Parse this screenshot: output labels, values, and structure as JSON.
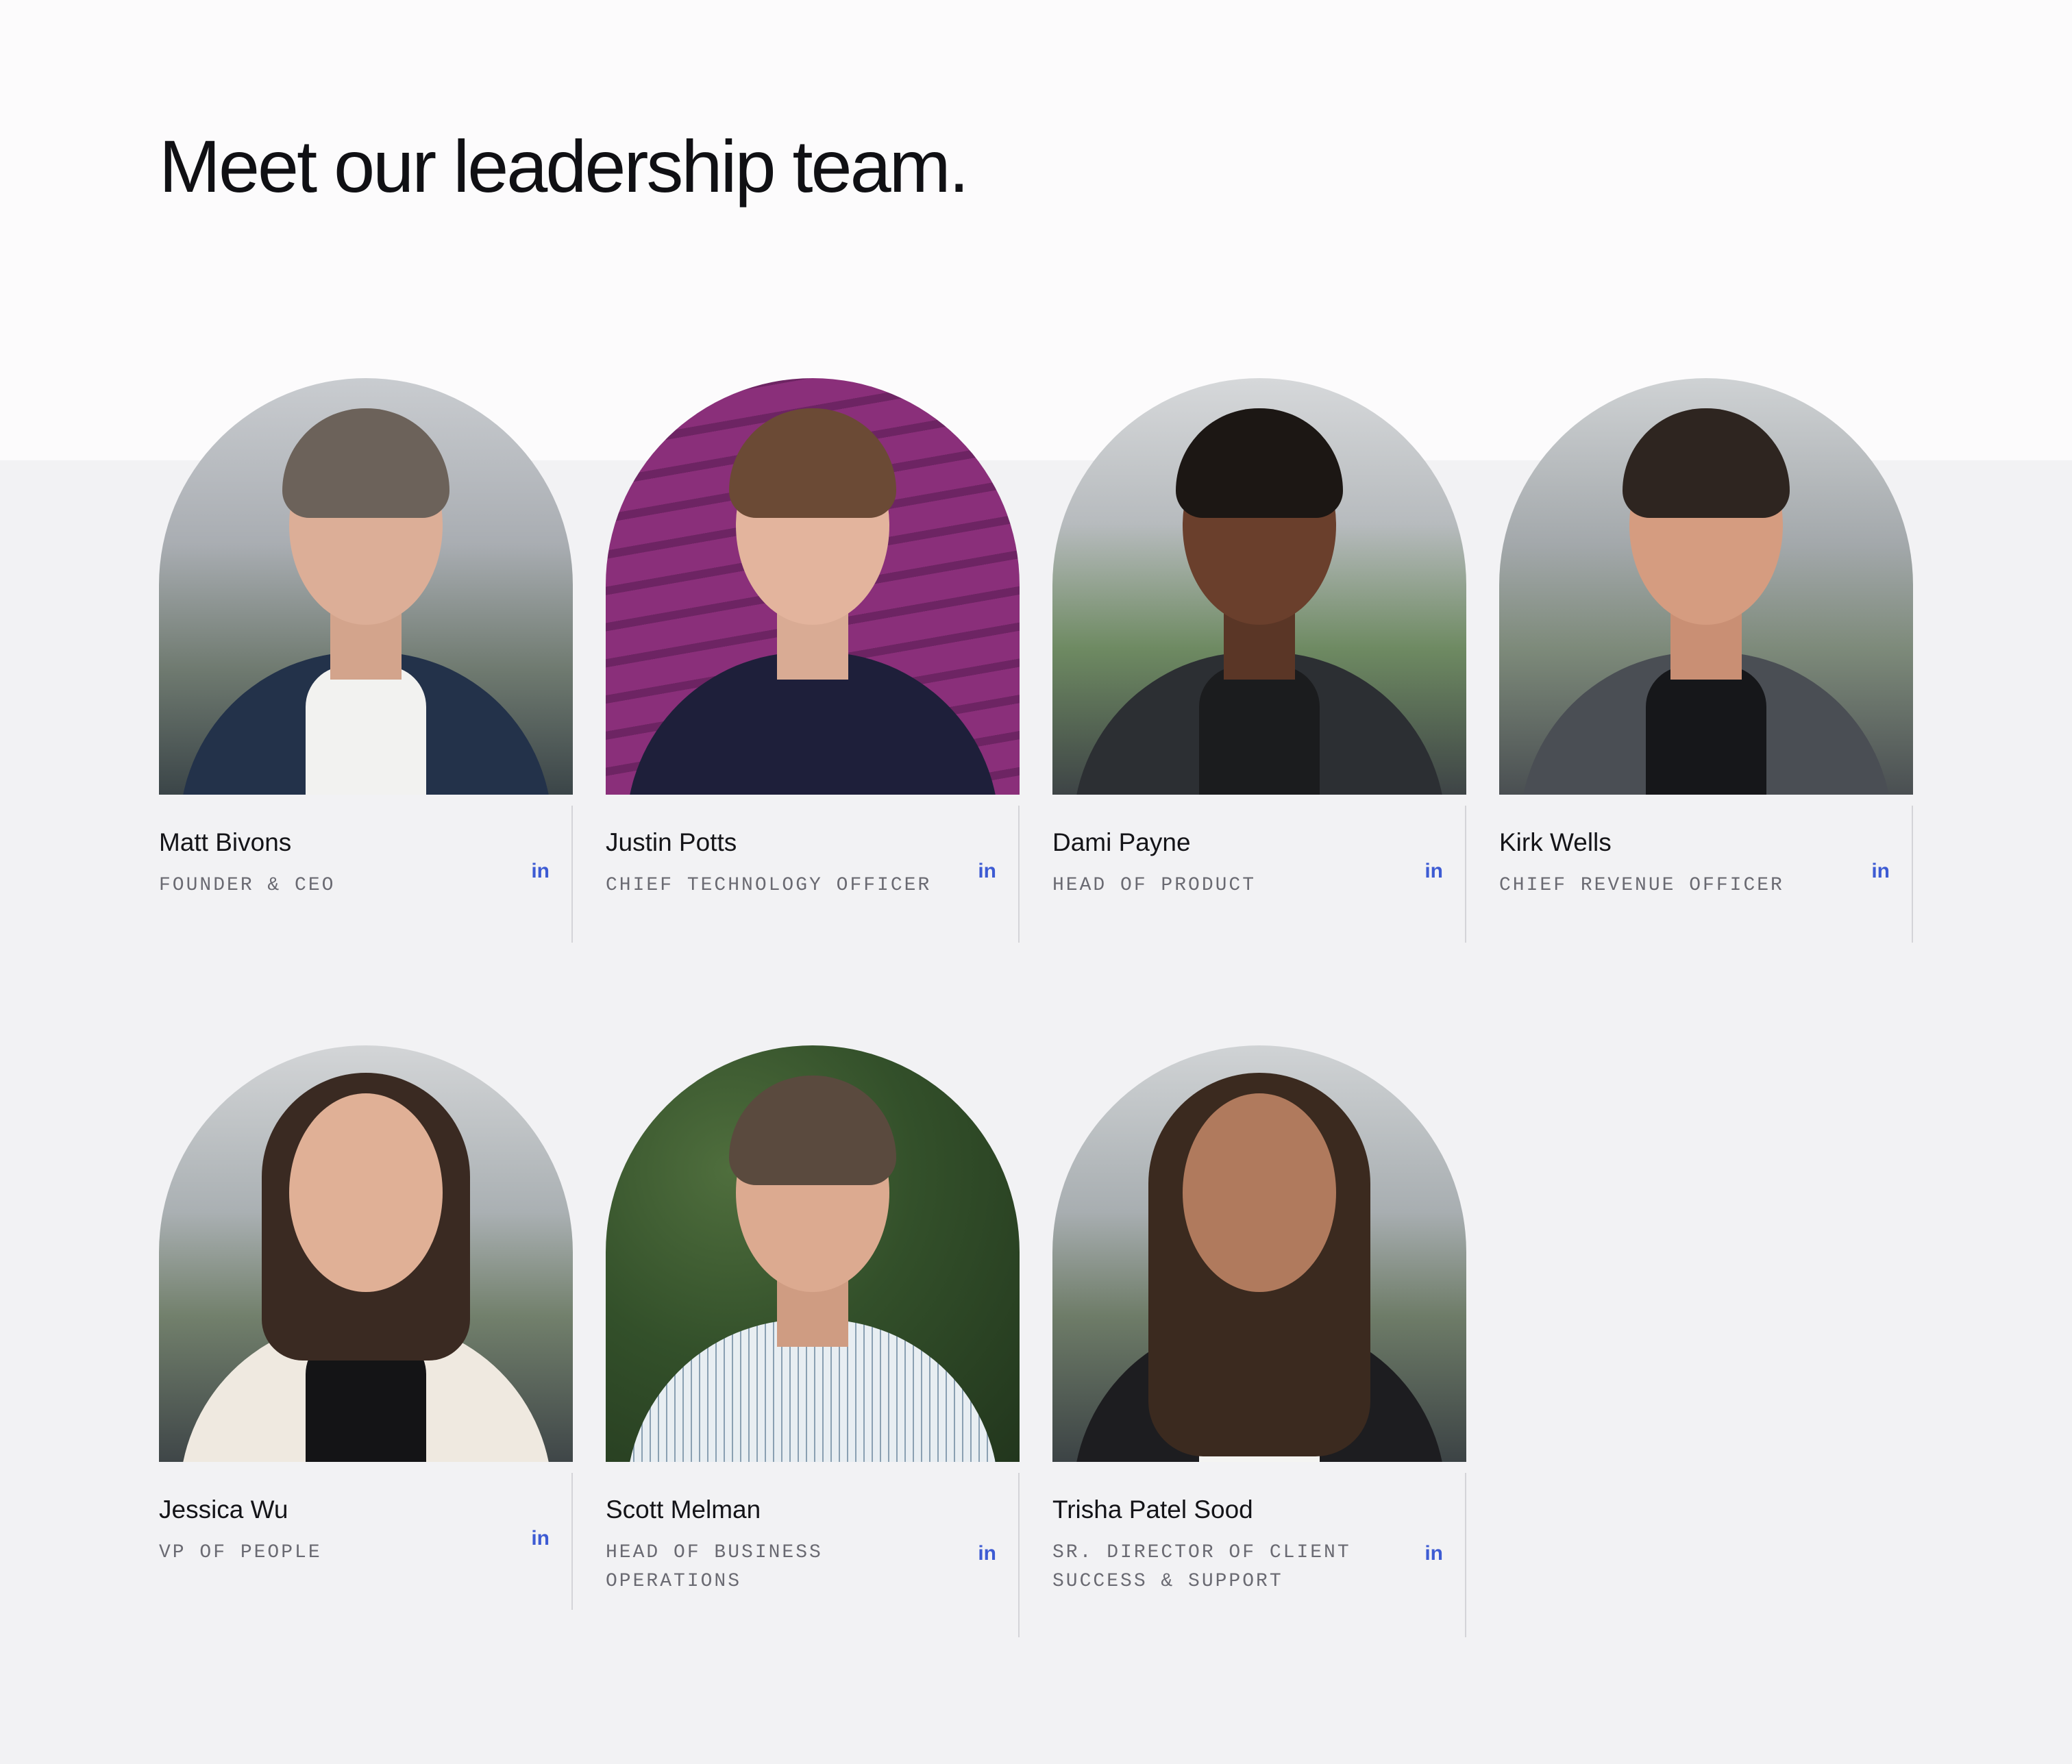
{
  "page": {
    "heading": "Meet our leadership team."
  },
  "team": [
    {
      "name": "Matt Bivons",
      "role": "FOUNDER & CEO",
      "linkedin_label": "in",
      "photo_alt": "Portrait of Matt Bivons"
    },
    {
      "name": "Justin Potts",
      "role": "CHIEF TECHNOLOGY OFFICER",
      "linkedin_label": "in",
      "photo_alt": "Portrait of Justin Potts"
    },
    {
      "name": "Dami Payne",
      "role": "HEAD OF PRODUCT",
      "linkedin_label": "in",
      "photo_alt": "Portrait of Dami Payne"
    },
    {
      "name": "Kirk Wells",
      "role": "CHIEF REVENUE OFFICER",
      "linkedin_label": "in",
      "photo_alt": "Portrait of Kirk Wells"
    },
    {
      "name": "Jessica Wu",
      "role": "VP OF PEOPLE",
      "linkedin_label": "in",
      "photo_alt": "Portrait of Jessica Wu"
    },
    {
      "name": "Scott Melman",
      "role": "HEAD OF BUSINESS OPERATIONS",
      "linkedin_label": "in",
      "photo_alt": "Portrait of Scott Melman"
    },
    {
      "name": "Trisha Patel Sood",
      "role": "SR. DIRECTOR OF CLIENT SUCCESS & SUPPORT",
      "linkedin_label": "in",
      "photo_alt": "Portrait of Trisha Patel Sood"
    }
  ],
  "colors": {
    "page_background": "#f2f2f4",
    "top_band": "#fcfbfc",
    "heading_text": "#101014",
    "role_text": "#6a6a72",
    "linkedin_accent": "#3d5bd3",
    "divider": "#d4d4d8"
  },
  "icons": {
    "linkedin": "linkedin-icon"
  }
}
